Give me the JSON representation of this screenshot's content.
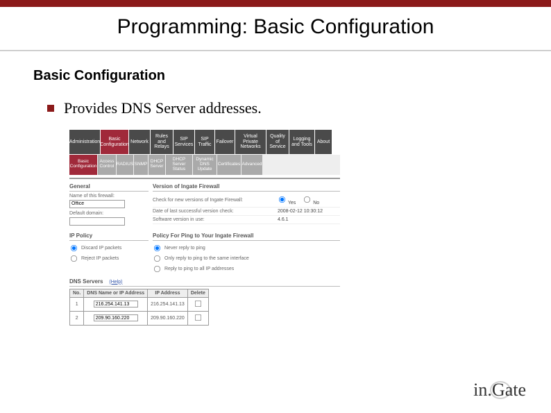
{
  "slide": {
    "title": "Programming: Basic Configuration",
    "section": "Basic Configuration",
    "bullet": "Provides DNS Server addresses."
  },
  "main_tabs": [
    {
      "label": "Administration"
    },
    {
      "label": "Basic Configuration"
    },
    {
      "label": "Network"
    },
    {
      "label": "Rules and Relays"
    },
    {
      "label": "SIP Services"
    },
    {
      "label": "SIP Traffic"
    },
    {
      "label": "Failover"
    },
    {
      "label": "Virtual Private Networks"
    },
    {
      "label": "Quality of Service"
    },
    {
      "label": "Logging and Tools"
    },
    {
      "label": "About"
    }
  ],
  "sub_tabs": [
    {
      "label": "Basic Configuration"
    },
    {
      "label": "Access Control"
    },
    {
      "label": "RADIUS"
    },
    {
      "label": "SNMP"
    },
    {
      "label": "DHCP Server"
    },
    {
      "label": "DHCP Server Status"
    },
    {
      "label": "Dynamic DNS Update"
    },
    {
      "label": "Certificates"
    },
    {
      "label": "Advanced"
    }
  ],
  "general": {
    "heading": "General",
    "name_label": "Name of this firewall:",
    "name_value": "Office",
    "domain_label": "Default domain:",
    "domain_value": ""
  },
  "version": {
    "heading": "Version of Ingate Firewall",
    "check_label": "Check for new versions of Ingate Firewall:",
    "yes": "Yes",
    "no": "No",
    "last_check_label": "Date of last successful version check:",
    "last_check_value": "2008-02-12 10:30:12",
    "sw_label": "Software version in use:",
    "sw_value": "4.6.1"
  },
  "ip_policy": {
    "heading": "IP Policy",
    "opt1": "Discard IP packets",
    "opt2": "Reject IP packets"
  },
  "ping_policy": {
    "heading": "Policy For Ping to Your Ingate Firewall",
    "opt1": "Never reply to ping",
    "opt2": "Only reply to ping to the same interface",
    "opt3": "Reply to ping to all IP addresses"
  },
  "dns": {
    "heading": "DNS Servers",
    "help": "(Help)",
    "cols": {
      "no": "No.",
      "name": "DNS Name or IP Address",
      "ip": "IP Address",
      "del": "Delete"
    },
    "rows": [
      {
        "no": "1",
        "name": "216.254.141.13",
        "ip": "216.254.141.13"
      },
      {
        "no": "2",
        "name": "209.90.160.220",
        "ip": "209.90.160.220"
      }
    ]
  },
  "logo": {
    "text_in": "in.",
    "text_g": "G",
    "text_ate": "ate"
  }
}
